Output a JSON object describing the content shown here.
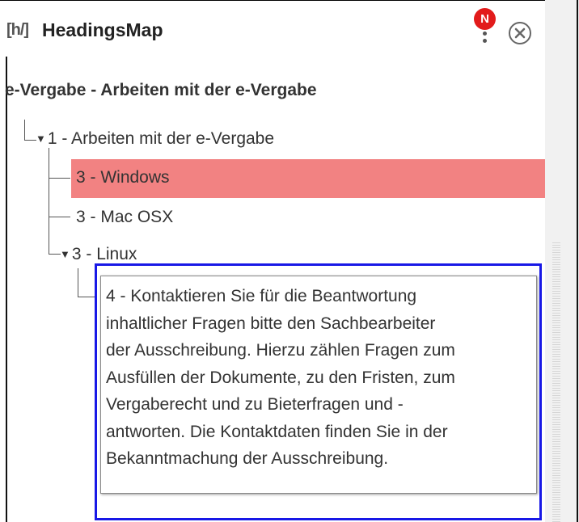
{
  "panel": {
    "logo_text": "[h/]",
    "title": "HeadingsMap",
    "notification_badge": "N",
    "menu_icon": "vertical-dots-icon",
    "close_icon": "close-circle-icon"
  },
  "document_title": "e-Vergabe - Arbeiten mit der e-Vergabe",
  "headings": [
    {
      "level": "1",
      "label": "1 -  Arbeiten mit der e-Vergabe",
      "expanded": true
    },
    {
      "level": "3",
      "label": "3 -  Windows",
      "active": true
    },
    {
      "level": "3",
      "label": "3 -  Mac OSX"
    },
    {
      "level": "3",
      "label": "3 -  Linux",
      "expanded": true
    },
    {
      "level": "4",
      "label": "4 - Kontaktieren Sie für die Beantwortung inhaltlicher Fragen bitte den Sachbearbeiter der Ausschreibung. Hierzu zählen Fragen zum Ausfüllen der Dokumente, zu den Fristen, zum Vergaberecht und zu Bieterfragen und -antworten. Die Kontaktdaten finden Sie in der Bekanntmachung der Ausschreibung."
    }
  ],
  "tooltip_text": "4 - Kontaktieren Sie für die Beantwortung\ninhaltlicher Fragen bitte den Sachbearbeiter\nder Ausschreibung. Hierzu zählen Fragen zum\nAusfüllen der Dokumente, zu den Fristen, zum\nVergaberecht und zu Bieterfragen und -\nantworten. Die Kontaktdaten finden Sie in der\nBekanntmachung der Ausschreibung.",
  "colors": {
    "active_highlight": "#f28282",
    "notification": "#e21b1b",
    "focus_outline": "#1818e6"
  }
}
